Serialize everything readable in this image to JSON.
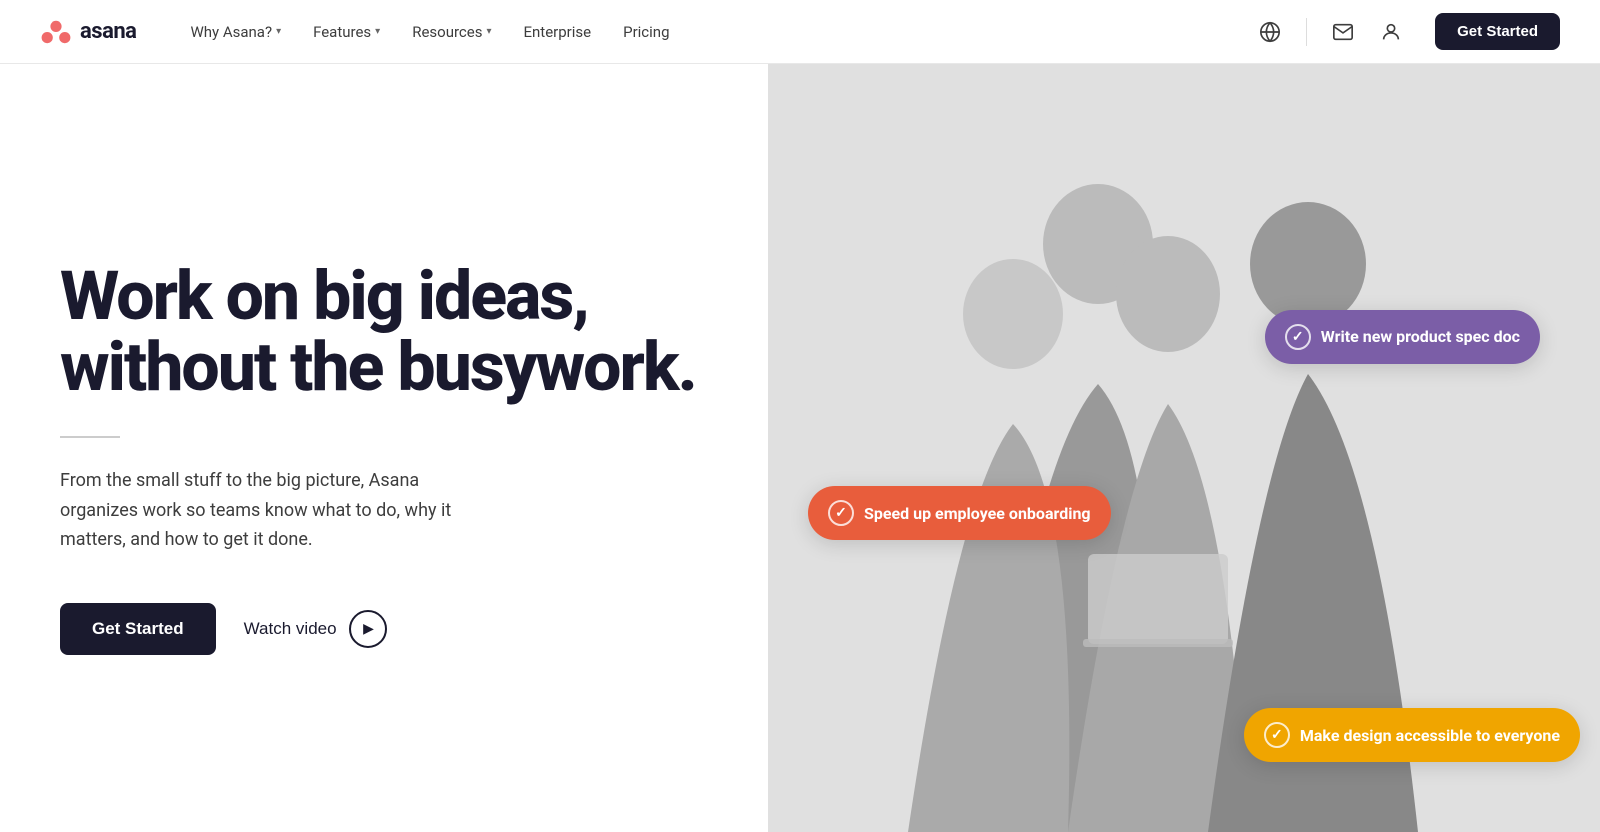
{
  "brand": {
    "name": "asana",
    "logo_alt": "Asana logo"
  },
  "nav": {
    "links": [
      {
        "label": "Why Asana?",
        "has_dropdown": true
      },
      {
        "label": "Features",
        "has_dropdown": true
      },
      {
        "label": "Resources",
        "has_dropdown": true
      },
      {
        "label": "Enterprise",
        "has_dropdown": false
      },
      {
        "label": "Pricing",
        "has_dropdown": false
      }
    ],
    "get_started_label": "Get Started",
    "globe_icon": "🌐",
    "mail_icon": "✉",
    "user_icon": "👤"
  },
  "hero": {
    "headline_line1": "Work on big ideas,",
    "headline_line2": "without the busywork.",
    "body": "From the small stuff to the big picture, Asana organizes work so teams know what to do, why it matters, and how to get it done.",
    "cta_primary": "Get Started",
    "cta_secondary": "Watch video",
    "chips": [
      {
        "label": "Write new product spec doc",
        "color": "#7b5ea7",
        "id": "purple"
      },
      {
        "label": "Speed up employee onboarding",
        "color": "#e85d3c",
        "id": "red"
      },
      {
        "label": "Make design accessible to everyone",
        "color": "#f0a500",
        "id": "orange"
      }
    ]
  }
}
